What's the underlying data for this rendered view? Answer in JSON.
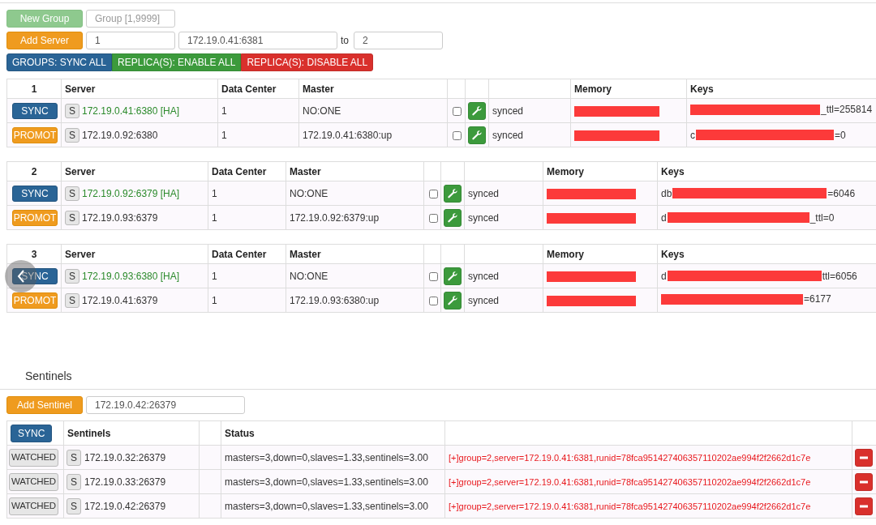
{
  "toolbar": {
    "new_group_button": "New Group",
    "group_field": {
      "placeholder": "Group [1,9999]"
    },
    "add_server_button": "Add Server",
    "group_value": "1",
    "server_value": "172.19.0.41:6381",
    "to_label": "to",
    "to_value": "2",
    "actions": [
      {
        "label": "GROUPS: SYNC ALL",
        "kind": "primary"
      },
      {
        "label": "REPLICA(S): ENABLE ALL",
        "kind": "success"
      },
      {
        "label": "REPLICA(S): DISABLE ALL",
        "kind": "danger"
      }
    ]
  },
  "groups": [
    {
      "id": "1",
      "server_heading": "Server",
      "data_center_heading": "Data Center",
      "master_heading": "Master",
      "memory_heading": "Memory",
      "keys_heading": "Keys",
      "rows": [
        {
          "action": "SYNC",
          "kind": "primary",
          "s": "S",
          "server": "172.19.0.41:6380 [HA]",
          "is_master": true,
          "data_center": "1",
          "master": "NO:ONE",
          "checked": false,
          "status": "synced",
          "keys_prefix": "",
          "keys_suffix": "_ttl=255814"
        },
        {
          "action": "PROMOT",
          "kind": "warning",
          "s": "S",
          "server": "172.19.0.92:6380",
          "is_master": false,
          "data_center": "1",
          "master": "172.19.0.41:6380:up",
          "checked": false,
          "status": "synced",
          "keys_prefix": "c",
          "keys_suffix": "=0"
        }
      ]
    },
    {
      "id": "2",
      "server_heading": "Server",
      "data_center_heading": "Data Center",
      "master_heading": "Master",
      "memory_heading": "Memory",
      "keys_heading": "Keys",
      "rows": [
        {
          "action": "SYNC",
          "kind": "primary",
          "s": "S",
          "server": "172.19.0.92:6379 [HA]",
          "is_master": true,
          "data_center": "1",
          "master": "NO:ONE",
          "checked": false,
          "status": "synced",
          "keys_prefix": "db",
          "keys_suffix": "=6046"
        },
        {
          "action": "PROMOT",
          "kind": "warning",
          "s": "S",
          "server": "172.19.0.93:6379",
          "is_master": false,
          "data_center": "1",
          "master": "172.19.0.92:6379:up",
          "checked": false,
          "status": "synced",
          "keys_prefix": "d",
          "keys_suffix": "_ttl=0"
        }
      ]
    },
    {
      "id": "3",
      "server_heading": "Server",
      "data_center_heading": "Data Center",
      "master_heading": "Master",
      "memory_heading": "Memory",
      "keys_heading": "Keys",
      "rows": [
        {
          "action": "SYNC",
          "kind": "primary",
          "s": "S",
          "server": "172.19.0.93:6380 [HA]",
          "is_master": true,
          "data_center": "1",
          "master": "NO:ONE",
          "checked": false,
          "status": "synced",
          "keys_prefix": "d",
          "keys_suffix": "ttl=6056"
        },
        {
          "action": "PROMOT",
          "kind": "warning",
          "s": "S",
          "server": "172.19.0.41:6379",
          "is_master": false,
          "data_center": "1",
          "master": "172.19.0.93:6380:up",
          "checked": false,
          "status": "synced",
          "keys_prefix": "",
          "keys_suffix": "=6177"
        }
      ]
    }
  ],
  "sentinels": {
    "title": "Sentinels",
    "add_button": "Add Sentinel",
    "address_value": "172.19.0.42:26379",
    "sync_button": "SYNC",
    "sentinels_heading": "Sentinels",
    "status_heading": "Status",
    "rows": [
      {
        "button": "WATCHED",
        "s": "S",
        "address": "172.19.0.32:26379",
        "status": "masters=3,down=0,slaves=1.33,sentinels=3.00",
        "detail": "[+]group=2,server=172.19.0.41:6381,runid=78fca951427406357110202ae994f2f2662d1c7e"
      },
      {
        "button": "WATCHED",
        "s": "S",
        "address": "172.19.0.33:26379",
        "status": "masters=3,down=0,slaves=1.33,sentinels=3.00",
        "detail": "[+]group=2,server=172.19.0.41:6381,runid=78fca951427406357110202ae994f2f2662d1c7e"
      },
      {
        "button": "WATCHED",
        "s": "S",
        "address": "172.19.0.42:26379",
        "status": "masters=3,down=0,slaves=1.33,sentinels=3.00",
        "detail": "[+]group=2,server=172.19.0.41:6381,runid=78fca951427406357110202ae994f2f2662d1c7e"
      }
    ]
  }
}
